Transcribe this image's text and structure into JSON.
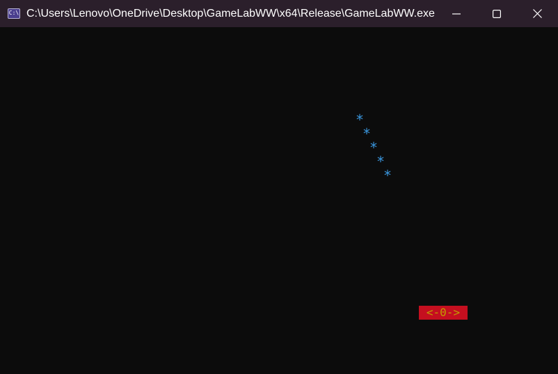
{
  "window": {
    "title": "C:\\Users\\Lenovo\\OneDrive\\Desktop\\GameLabWW\\x64\\Release\\GameLabWW.exe",
    "icon": "C:\\",
    "controls": {
      "minimize_icon": "minimize-icon",
      "maximize_icon": "maximize-icon",
      "close_icon": "close-icon"
    }
  },
  "console": {
    "background_color": "#0c0c0c",
    "stars": [
      "*",
      "*",
      "*",
      "*",
      "*"
    ],
    "star_color": "#3a96dd",
    "paddle": {
      "text": "<-0->",
      "background_color": "#c50f1f",
      "text_color": "#c19c00"
    }
  }
}
